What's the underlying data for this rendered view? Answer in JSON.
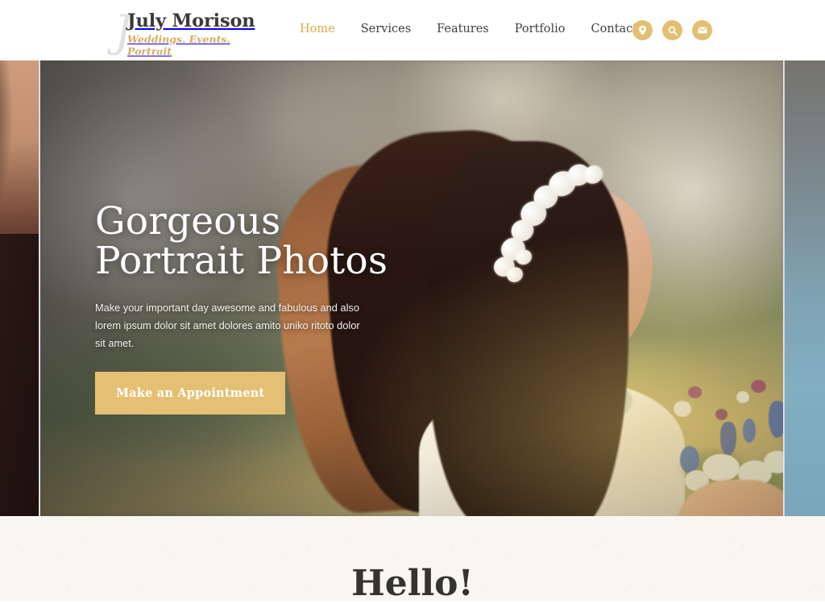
{
  "header": {
    "brand": {
      "monogram": "J",
      "name": "July Morison",
      "tagline": "Weddings. Events. Portrait"
    },
    "nav": [
      {
        "label": "Home",
        "active": true
      },
      {
        "label": "Services",
        "active": false
      },
      {
        "label": "Features",
        "active": false
      },
      {
        "label": "Portfolio",
        "active": false
      },
      {
        "label": "Contacts",
        "active": false
      }
    ],
    "actions": [
      {
        "icon": "map-pin-icon",
        "label": "Location"
      },
      {
        "icon": "search-icon",
        "label": "Search"
      },
      {
        "icon": "mail-icon",
        "label": "Contact"
      }
    ]
  },
  "hero": {
    "title_line1": "Gorgeous",
    "title_line2": "Portrait Photos",
    "description": "Make your important day awesome and fabulous and also lorem ipsum dolor sit amet dolores amito uniko ritoto dolor sit amet.",
    "cta_label": "Make an Appointment",
    "slide_alt": "Bride with white flower crown holding a wildflower bouquet",
    "prev_slide_alt": "Previous slide preview",
    "next_slide_alt": "Next slide preview"
  },
  "hello": {
    "title": "Hello!"
  },
  "colors": {
    "accent_gold": "#e4c074",
    "nav_active": "#dfa94b",
    "tagline_gold": "#d9ab5e",
    "header_bg": "#ffffff",
    "section_cream": "#f9f6f0",
    "heading_dark": "#35332f",
    "hero_text": "#ffffff"
  }
}
